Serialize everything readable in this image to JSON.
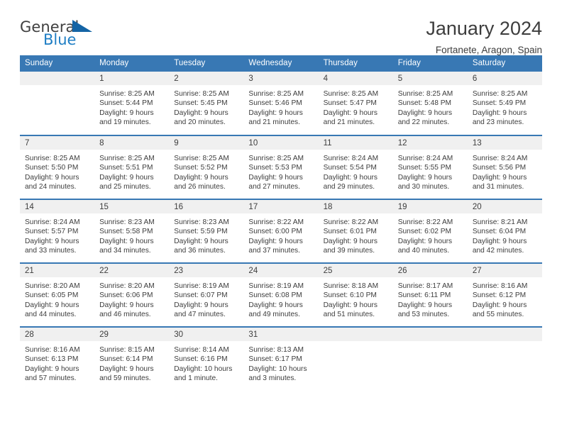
{
  "brand": {
    "name_top": "General",
    "name_bottom": "Blue",
    "accent_color": "#1f7ec4",
    "triangle_color": "#1464a5"
  },
  "header": {
    "title": "January 2024",
    "subtitle": "Fortanete, Aragon, Spain"
  },
  "theme": {
    "header_blue": "#3878b4",
    "daynum_band": "#f0f0f0",
    "text": "#3d3d3d"
  },
  "weekday_headers": [
    "Sunday",
    "Monday",
    "Tuesday",
    "Wednesday",
    "Thursday",
    "Friday",
    "Saturday"
  ],
  "weeks": [
    [
      {
        "day": "",
        "lines": []
      },
      {
        "day": "1",
        "lines": [
          "Sunrise: 8:25 AM",
          "Sunset: 5:44 PM",
          "Daylight: 9 hours",
          "and 19 minutes."
        ]
      },
      {
        "day": "2",
        "lines": [
          "Sunrise: 8:25 AM",
          "Sunset: 5:45 PM",
          "Daylight: 9 hours",
          "and 20 minutes."
        ]
      },
      {
        "day": "3",
        "lines": [
          "Sunrise: 8:25 AM",
          "Sunset: 5:46 PM",
          "Daylight: 9 hours",
          "and 21 minutes."
        ]
      },
      {
        "day": "4",
        "lines": [
          "Sunrise: 8:25 AM",
          "Sunset: 5:47 PM",
          "Daylight: 9 hours",
          "and 21 minutes."
        ]
      },
      {
        "day": "5",
        "lines": [
          "Sunrise: 8:25 AM",
          "Sunset: 5:48 PM",
          "Daylight: 9 hours",
          "and 22 minutes."
        ]
      },
      {
        "day": "6",
        "lines": [
          "Sunrise: 8:25 AM",
          "Sunset: 5:49 PM",
          "Daylight: 9 hours",
          "and 23 minutes."
        ]
      }
    ],
    [
      {
        "day": "7",
        "lines": [
          "Sunrise: 8:25 AM",
          "Sunset: 5:50 PM",
          "Daylight: 9 hours",
          "and 24 minutes."
        ]
      },
      {
        "day": "8",
        "lines": [
          "Sunrise: 8:25 AM",
          "Sunset: 5:51 PM",
          "Daylight: 9 hours",
          "and 25 minutes."
        ]
      },
      {
        "day": "9",
        "lines": [
          "Sunrise: 8:25 AM",
          "Sunset: 5:52 PM",
          "Daylight: 9 hours",
          "and 26 minutes."
        ]
      },
      {
        "day": "10",
        "lines": [
          "Sunrise: 8:25 AM",
          "Sunset: 5:53 PM",
          "Daylight: 9 hours",
          "and 27 minutes."
        ]
      },
      {
        "day": "11",
        "lines": [
          "Sunrise: 8:24 AM",
          "Sunset: 5:54 PM",
          "Daylight: 9 hours",
          "and 29 minutes."
        ]
      },
      {
        "day": "12",
        "lines": [
          "Sunrise: 8:24 AM",
          "Sunset: 5:55 PM",
          "Daylight: 9 hours",
          "and 30 minutes."
        ]
      },
      {
        "day": "13",
        "lines": [
          "Sunrise: 8:24 AM",
          "Sunset: 5:56 PM",
          "Daylight: 9 hours",
          "and 31 minutes."
        ]
      }
    ],
    [
      {
        "day": "14",
        "lines": [
          "Sunrise: 8:24 AM",
          "Sunset: 5:57 PM",
          "Daylight: 9 hours",
          "and 33 minutes."
        ]
      },
      {
        "day": "15",
        "lines": [
          "Sunrise: 8:23 AM",
          "Sunset: 5:58 PM",
          "Daylight: 9 hours",
          "and 34 minutes."
        ]
      },
      {
        "day": "16",
        "lines": [
          "Sunrise: 8:23 AM",
          "Sunset: 5:59 PM",
          "Daylight: 9 hours",
          "and 36 minutes."
        ]
      },
      {
        "day": "17",
        "lines": [
          "Sunrise: 8:22 AM",
          "Sunset: 6:00 PM",
          "Daylight: 9 hours",
          "and 37 minutes."
        ]
      },
      {
        "day": "18",
        "lines": [
          "Sunrise: 8:22 AM",
          "Sunset: 6:01 PM",
          "Daylight: 9 hours",
          "and 39 minutes."
        ]
      },
      {
        "day": "19",
        "lines": [
          "Sunrise: 8:22 AM",
          "Sunset: 6:02 PM",
          "Daylight: 9 hours",
          "and 40 minutes."
        ]
      },
      {
        "day": "20",
        "lines": [
          "Sunrise: 8:21 AM",
          "Sunset: 6:04 PM",
          "Daylight: 9 hours",
          "and 42 minutes."
        ]
      }
    ],
    [
      {
        "day": "21",
        "lines": [
          "Sunrise: 8:20 AM",
          "Sunset: 6:05 PM",
          "Daylight: 9 hours",
          "and 44 minutes."
        ]
      },
      {
        "day": "22",
        "lines": [
          "Sunrise: 8:20 AM",
          "Sunset: 6:06 PM",
          "Daylight: 9 hours",
          "and 46 minutes."
        ]
      },
      {
        "day": "23",
        "lines": [
          "Sunrise: 8:19 AM",
          "Sunset: 6:07 PM",
          "Daylight: 9 hours",
          "and 47 minutes."
        ]
      },
      {
        "day": "24",
        "lines": [
          "Sunrise: 8:19 AM",
          "Sunset: 6:08 PM",
          "Daylight: 9 hours",
          "and 49 minutes."
        ]
      },
      {
        "day": "25",
        "lines": [
          "Sunrise: 8:18 AM",
          "Sunset: 6:10 PM",
          "Daylight: 9 hours",
          "and 51 minutes."
        ]
      },
      {
        "day": "26",
        "lines": [
          "Sunrise: 8:17 AM",
          "Sunset: 6:11 PM",
          "Daylight: 9 hours",
          "and 53 minutes."
        ]
      },
      {
        "day": "27",
        "lines": [
          "Sunrise: 8:16 AM",
          "Sunset: 6:12 PM",
          "Daylight: 9 hours",
          "and 55 minutes."
        ]
      }
    ],
    [
      {
        "day": "28",
        "lines": [
          "Sunrise: 8:16 AM",
          "Sunset: 6:13 PM",
          "Daylight: 9 hours",
          "and 57 minutes."
        ]
      },
      {
        "day": "29",
        "lines": [
          "Sunrise: 8:15 AM",
          "Sunset: 6:14 PM",
          "Daylight: 9 hours",
          "and 59 minutes."
        ]
      },
      {
        "day": "30",
        "lines": [
          "Sunrise: 8:14 AM",
          "Sunset: 6:16 PM",
          "Daylight: 10 hours",
          "and 1 minute."
        ]
      },
      {
        "day": "31",
        "lines": [
          "Sunrise: 8:13 AM",
          "Sunset: 6:17 PM",
          "Daylight: 10 hours",
          "and 3 minutes."
        ]
      },
      {
        "day": "",
        "lines": []
      },
      {
        "day": "",
        "lines": []
      },
      {
        "day": "",
        "lines": []
      }
    ]
  ]
}
